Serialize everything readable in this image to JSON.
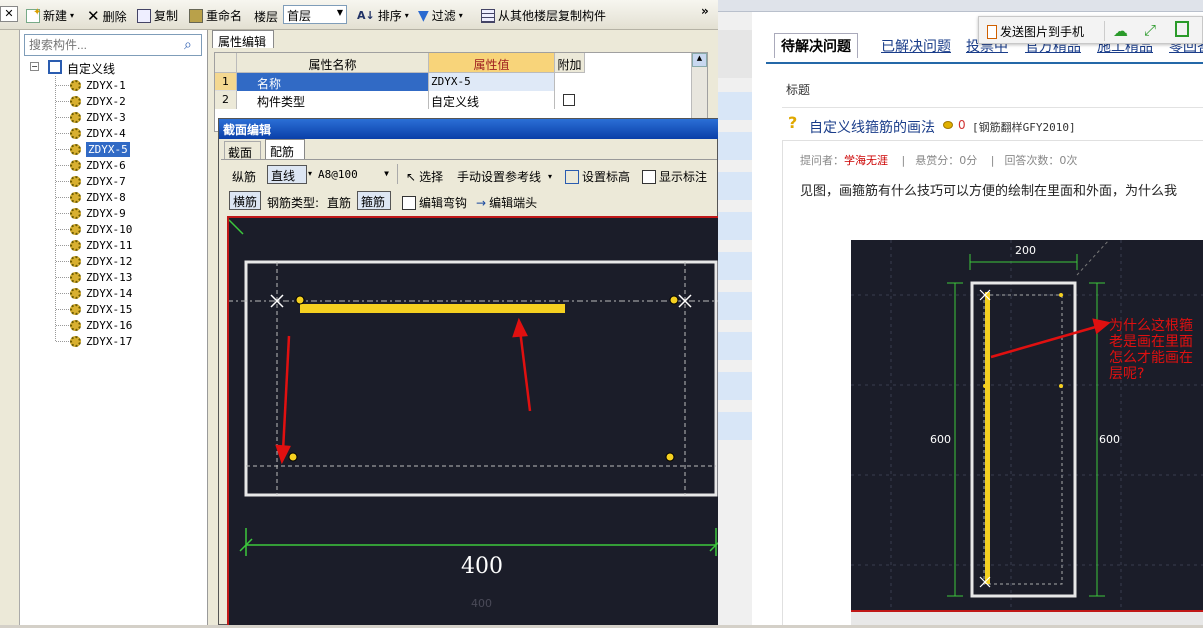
{
  "toolbar": {
    "new_label": "新建",
    "delete_label": "删除",
    "copy_label": "复制",
    "rename_label": "重命名",
    "floor_label": "楼层",
    "floor_value": "首层",
    "sort_label": "排序",
    "filter_label": "过滤",
    "copy_from_floor_label": "从其他楼层复制构件",
    "overflow_label": "»"
  },
  "tree": {
    "search_placeholder": "搜索构件...",
    "root_label": "自定义线",
    "items": [
      "ZDYX-1",
      "ZDYX-2",
      "ZDYX-3",
      "ZDYX-4",
      "ZDYX-5",
      "ZDYX-6",
      "ZDYX-7",
      "ZDYX-8",
      "ZDYX-9",
      "ZDYX-10",
      "ZDYX-11",
      "ZDYX-12",
      "ZDYX-13",
      "ZDYX-14",
      "ZDYX-15",
      "ZDYX-16",
      "ZDYX-17"
    ],
    "selected_index": 4
  },
  "properties": {
    "tab_label": "属性编辑",
    "col_name": "属性名称",
    "col_value": "属性值",
    "col_extra": "附加",
    "rows": [
      {
        "num": "1",
        "name": "名称",
        "value": "ZDYX-5"
      },
      {
        "num": "2",
        "name": "构件类型",
        "value": "自定义线"
      }
    ]
  },
  "section_editor": {
    "title": "截面编辑",
    "tabs": [
      "截面",
      "配筋"
    ],
    "active_tab": "配筋",
    "longitudinal_label": "纵筋",
    "line_mode": "直线",
    "rebar_value": "A8@100",
    "select_label": "选择",
    "ref_line_label": "手动设置参考线",
    "set_elevation_label": "设置标高",
    "show_annotation_label": "显示标注",
    "transverse_label": "横筋",
    "rebar_type_label": "钢筋类型:",
    "straight_label": "直筋",
    "stirrup_label": "箍筋",
    "edit_hook_label": "编辑弯钩",
    "edit_end_label": "编辑端头",
    "dimension_main": "400",
    "dimension_sub": "400"
  },
  "right_page": {
    "tabs": [
      "待解决问题",
      "已解决问题",
      "投票中",
      "官方精品",
      "施工精品",
      "零回答"
    ],
    "send_to_phone_label": "发送图片到手机",
    "section_title": "标题",
    "question_title": "自定义线箍筋的画法",
    "reward_value": "0",
    "category": "[钢筋翻样GFY2010]",
    "asker_label": "提问者：",
    "asker_name": "学海无涯",
    "reward_label": "悬赏分：0分",
    "answers_label": "回答次数：0次",
    "question_body": "见图，画箍筋有什么技巧可以方便的绘制在里面和外面，为什么我",
    "img_dim_top": "200",
    "img_dim_left": "600",
    "img_dim_right": "600",
    "img_annotation": [
      "为什么这根箍",
      "老是画在里面",
      "怎么才能画在",
      "层呢?"
    ]
  },
  "colors": {
    "canvas_bg": "#1b1d29",
    "rebar_yellow": "#f5d020",
    "arrow_red": "#e01010",
    "dim_green": "#3cc83c",
    "selection_blue": "#316ac5",
    "title_blue": "#0a3fa8",
    "link_blue": "#1a3d8a"
  }
}
